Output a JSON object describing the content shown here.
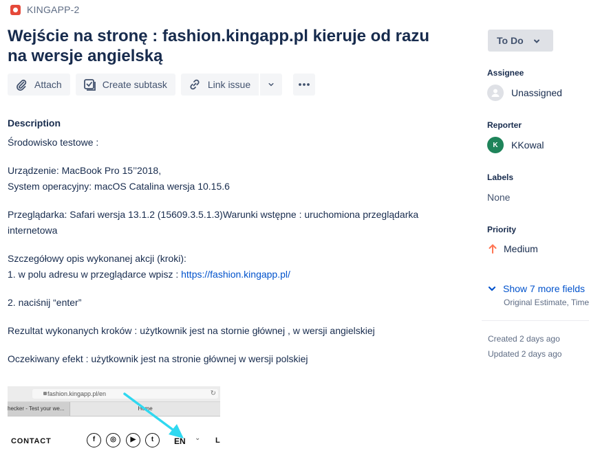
{
  "breadcrumb": {
    "issue_key": "KINGAPP-2",
    "icon": "bug-icon"
  },
  "issue": {
    "title": "Wejście na stronę : fashion.kingapp.pl kieruje od razu na wersje angielską"
  },
  "toolbar": {
    "attach_label": "Attach",
    "create_subtask_label": "Create subtask",
    "link_issue_label": "Link issue"
  },
  "description": {
    "heading": "Description",
    "line_env": "Środowisko testowe :",
    "line_device": "Urządzenie: MacBook Pro 15’’2018,",
    "line_os": "System operacyjny: macOS Catalina wersja 10.15.6",
    "line_browser": "Przeglądarka: Safari wersja 13.1.2 (15609.3.5.1.3)Warunki wstępne : uruchomiona przeglądarka internetowa",
    "line_steps_title": "Szczegółowy opis wykonanej akcji (kroki):",
    "line_step1_prefix": "1. w polu adresu w przeglądarce wpisz : ",
    "line_step1_link": "https://fashion.kingapp.pl/",
    "line_step2": "2. naciśnij “enter”",
    "line_result": "Rezultat wykonanych kroków : użytkownik jest na stornie głównej , w wersji angielskiej",
    "line_expected": "Oczekiwany efekt : użytkownik jest na stronie głównej w wersji polskiej"
  },
  "attachment": {
    "url_text": "fashion.kingapp.pl/en",
    "tab1_text": "hecker - Test your we...",
    "tab2_text": "Home",
    "contact_text": "CONTACT",
    "lang_text": "EN",
    "trailing_char": "L",
    "arrow_color": "#2fd8f0"
  },
  "sidebar": {
    "status_label": "To Do",
    "assignee_label": "Assignee",
    "assignee_value": "Unassigned",
    "reporter_label": "Reporter",
    "reporter_value": "KKowal",
    "reporter_initial": "K",
    "labels_label": "Labels",
    "labels_value": "None",
    "priority_label": "Priority",
    "priority_value": "Medium",
    "priority_color": "#ff7452",
    "show_more_label": "Show 7 more fields",
    "show_more_sub": "Original Estimate, Time tracking",
    "created": "Created 2 days ago",
    "updated": "Updated 2 days ago"
  }
}
